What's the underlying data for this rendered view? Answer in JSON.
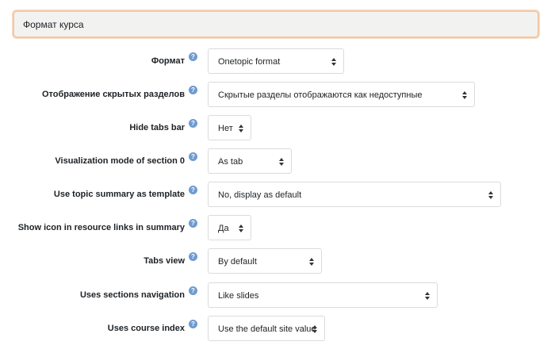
{
  "section": {
    "title": "Формат курса"
  },
  "help_glyph": "?",
  "fields": [
    {
      "label": "Формат",
      "value": "Onetopic format"
    },
    {
      "label": "Отображение скрытых разделов",
      "value": "Скрытые разделы отображаются как недоступные"
    },
    {
      "label": "Hide tabs bar",
      "value": "Нет"
    },
    {
      "label": "Visualization mode of section 0",
      "value": "As tab"
    },
    {
      "label": "Use topic summary as template",
      "value": "No, display as default"
    },
    {
      "label": "Show icon in resource links in summary",
      "value": "Да"
    },
    {
      "label": "Tabs view",
      "value": "By default"
    },
    {
      "label": "Uses sections navigation",
      "value": "Like slides"
    },
    {
      "label": "Uses course index",
      "value": "Use the default site value"
    }
  ]
}
